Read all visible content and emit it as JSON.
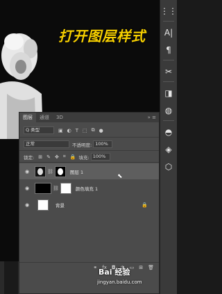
{
  "artboard": {
    "headline": "打开图层样式"
  },
  "toolbar": {
    "items": [
      "⋮⋮",
      "A|",
      "¶",
      "✂",
      "◨",
      "◍",
      "◓",
      "◈",
      "⬡"
    ]
  },
  "layers_panel": {
    "tabs": [
      {
        "label": "图层",
        "active": true
      },
      {
        "label": "通道",
        "active": false
      },
      {
        "label": "3D",
        "active": false
      }
    ],
    "controls": "»  ≡",
    "filter": {
      "value": "Q 类型"
    },
    "blend_mode": {
      "value": "正常"
    },
    "opacity": {
      "label": "不透明度:",
      "value": "100%"
    },
    "lock": {
      "label": "锁定:"
    },
    "fill": {
      "label": "填充:",
      "value": "100%"
    },
    "layers": [
      {
        "name": "图层 1",
        "selected": true
      },
      {
        "name": "颜色填充 1",
        "selected": false
      },
      {
        "name": "背景",
        "selected": false,
        "locked": true
      }
    ]
  },
  "watermark": {
    "brand": "Bai 经验",
    "url": "jingyan.baidu.com"
  }
}
